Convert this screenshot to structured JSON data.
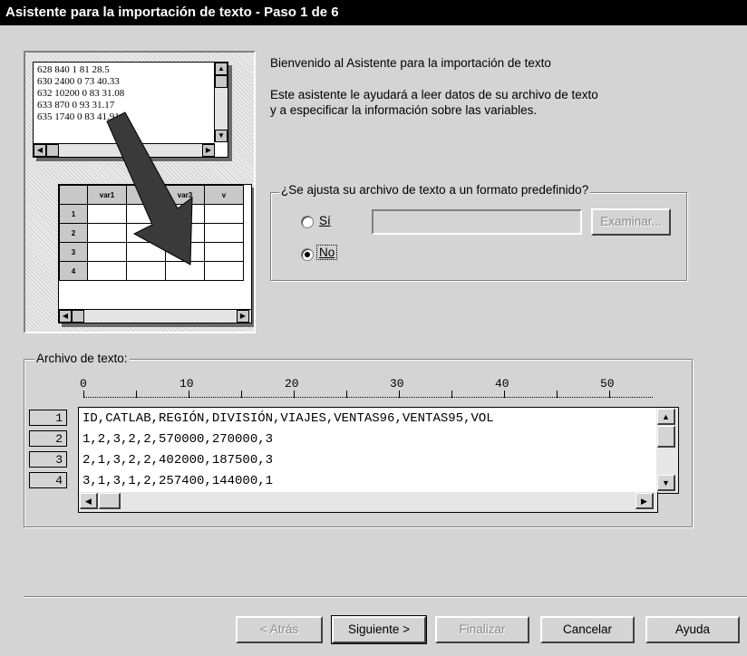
{
  "window": {
    "title": "Asistente para la importación de texto - Paso 1 de 6"
  },
  "illustration": {
    "text_lines": [
      "628 840 1 81 28.5",
      "630 2400 0 73 40.33",
      "632 10200 0 83 31.08",
      "633 870 0 93 31.17",
      "635 1740 0 83 41.91"
    ],
    "grid_headers": [
      "var1",
      "var2",
      "var3",
      "v"
    ],
    "grid_rows": [
      "1",
      "2",
      "3",
      "4"
    ]
  },
  "intro": {
    "welcome": "Bienvenido al Asistente para la importación de texto",
    "line1": "Este asistente le ayudará a leer datos de su archivo de texto",
    "line2": "y a especificar la información sobre las variables."
  },
  "format_group": {
    "legend": "¿Se ajusta su archivo de texto a un formato predefinido?",
    "option_yes": "Sí",
    "option_no": "No",
    "selected": "No",
    "path_value": "",
    "browse_label": "Examinar..."
  },
  "text_file": {
    "legend": "Archivo de texto:",
    "ruler_labels": [
      "0",
      "10",
      "20",
      "30",
      "40",
      "50"
    ],
    "row_numbers": [
      "1",
      "2",
      "3",
      "4"
    ],
    "lines": [
      "ID,CATLAB,REGIÓN,DIVISIÓN,VIAJES,VENTAS96,VENTAS95,VOL",
      "1,2,3,2,2,570000,270000,3",
      "2,1,3,2,2,402000,187500,3",
      "3,1,3,1,2,257400,144000,1"
    ]
  },
  "buttons": {
    "back": "< Atrás",
    "next": "Siguiente >",
    "finish": "Finalizar",
    "cancel": "Cancelar",
    "help": "Ayuda"
  }
}
